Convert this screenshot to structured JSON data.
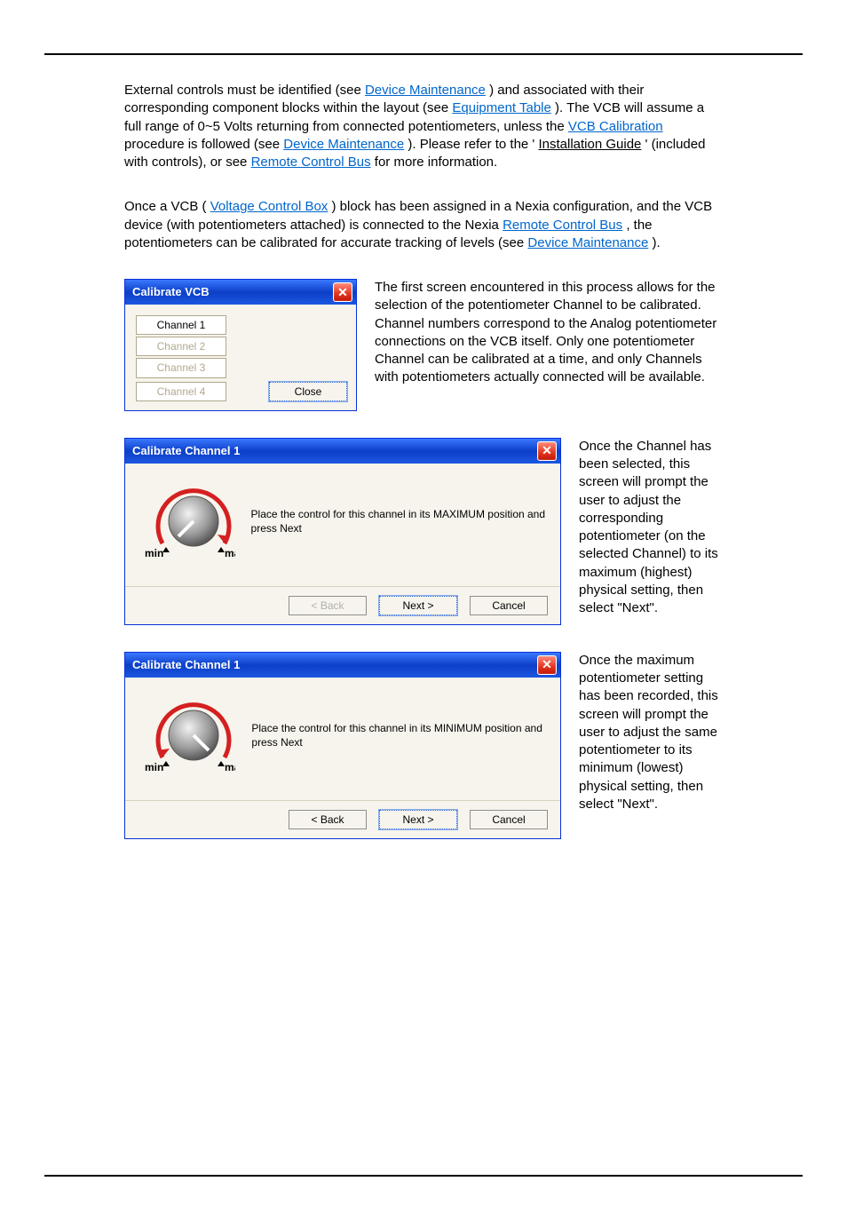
{
  "para1": {
    "t1": "External controls must be identified (see ",
    "link1": "Device Maintenance",
    "t2": ") and associated with their corresponding component blocks within the layout (see ",
    "link2": "Equipment Table",
    "t3": "). The VCB will assume a full range of 0~5 Volts returning from connected potentiometers, unless the ",
    "link3": "VCB Calibration",
    "t4": " procedure is followed (see ",
    "link4": "Device Maintenance",
    "t5": "). Please refer to the '",
    "u1": "Installation Guide",
    "t6": "' (included with controls), or see ",
    "link5": "Remote Control Bus",
    "t7": " for more information."
  },
  "para2": {
    "t1": "Once a VCB (",
    "link1": "Voltage Control Box",
    "t2": ") block has been assigned in a Nexia configuration, and the VCB device (with potentiometers attached) is connected to the Nexia ",
    "link2": "Remote Control Bus",
    "t3": ", the potentiometers can be calibrated for accurate tracking of levels (see ",
    "link3": "Device Maintenance",
    "t4": ")."
  },
  "dlg1": {
    "title": "Calibrate VCB",
    "channels": [
      "Channel 1",
      "Channel 2",
      "Channel 3",
      "Channel 4"
    ],
    "close": "Close"
  },
  "side1": "The first screen encountered in this process allows for the selection of the potentiometer Channel to be calibrated. Channel numbers correspond to the Analog potentiometer connections on the VCB itself. Only one potentiometer Channel can be calibrated at a time, and only Channels with potentiometers actually connected will be available.",
  "dlg2": {
    "title": "Calibrate Channel 1",
    "instr": "Place the control for this channel in its MAXIMUM position and press Next",
    "back": "< Back",
    "next": "Next >",
    "cancel": "Cancel",
    "min": "min",
    "max": "max"
  },
  "side2": "Once the Channel has been selected, this screen will prompt the user to adjust the corresponding potentiometer (on the selected Channel) to its maximum (highest) physical setting, then select \"Next\".",
  "dlg3": {
    "title": "Calibrate Channel 1",
    "instr": "Place the control for this channel in its MINIMUM position and press Next",
    "back": "< Back",
    "next": "Next >",
    "cancel": "Cancel",
    "min": "min",
    "max": "max"
  },
  "side3": "Once the maximum potentiometer setting has been recorded, this screen will prompt the user to adjust the same potentiometer to its minimum (lowest) physical setting, then select \"Next\"."
}
